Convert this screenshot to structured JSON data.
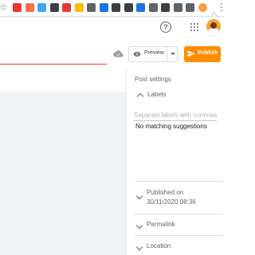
{
  "toolbar": {
    "extensions": [
      {
        "name": "extension-1-icon",
        "color": "#e53935"
      },
      {
        "name": "extension-2-icon",
        "color": "#ff7043"
      },
      {
        "name": "extension-3-icon",
        "color": "#42a5f5"
      },
      {
        "name": "camera-icon",
        "color": "#3c4043"
      },
      {
        "name": "youtube-icon",
        "color": "#e53935"
      },
      {
        "name": "drive-icon",
        "color": "#fbbc04"
      },
      {
        "name": "translate-icon",
        "color": "#5f6368"
      },
      {
        "name": "atom-icon",
        "color": "#1a73e8"
      },
      {
        "name": "wave-icon",
        "color": "#3c4043"
      },
      {
        "name": "ruler-icon",
        "color": "#3c4043"
      },
      {
        "name": "bookmark-icon",
        "color": "#1a73e8"
      },
      {
        "name": "list-icon",
        "color": "#5f6368"
      },
      {
        "name": "half-circle-icon",
        "color": "#3c4043"
      },
      {
        "name": "puzzle-icon",
        "color": "#5f6368"
      },
      {
        "name": "cast-icon",
        "color": "#5f6368"
      },
      {
        "name": "profile-avatar-icon",
        "color": "#f4a340"
      }
    ]
  },
  "header": {
    "help_icon_glyph": "?",
    "apps_icon": "apps-grid-icon",
    "avatar_color": "#f4a340"
  },
  "editor": {
    "title_underline_color": "#ea4335",
    "save_status_icon": "cloud-done-icon"
  },
  "actions": {
    "preview_label": "Preview",
    "publish_label": "Publish",
    "publish_color": "#fb8c00"
  },
  "settings": {
    "title": "Post settings",
    "labels": {
      "title": "Labels",
      "placeholder": "Separate labels with commas",
      "suggestion": "No matching suggestions"
    },
    "published": {
      "line1": "Published on",
      "line2": "30/11/2020 08:36"
    },
    "permalink": "Permalink",
    "location": "Location"
  }
}
